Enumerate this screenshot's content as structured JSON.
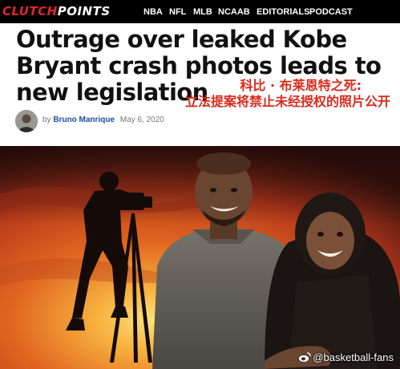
{
  "header": {
    "logo_part1": "CLUTCH",
    "logo_part2": "POINTS",
    "nav": [
      "NBA",
      "NFL",
      "MLB",
      "NCAAB",
      "EDITORIALS",
      "PODCAST"
    ]
  },
  "article": {
    "headline": "Outrage over leaked Kobe Bryant crash photos leads to new legislation",
    "caption_cn_line1": "科比 · 布莱恩特之死:",
    "caption_cn_line2": "立法提案将禁止未经授权的照片公开",
    "byline_prefix": "by",
    "author": "Bruno Manrique",
    "date": "May 6, 2020"
  },
  "hero": {
    "watermark": "@basketball-fans",
    "colors": {
      "sky_top": "#2b0f0c",
      "sky_mid": "#b3361b",
      "sun": "#f7b240"
    }
  }
}
